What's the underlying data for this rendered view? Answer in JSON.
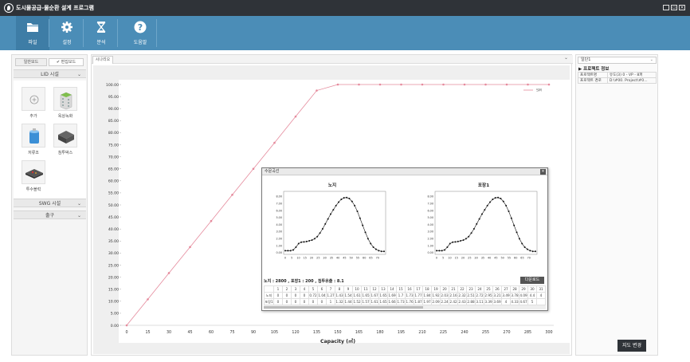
{
  "window": {
    "title": "도시물공급-물순환 설계 프로그램",
    "controls": [
      "_",
      "▭",
      "×"
    ]
  },
  "toolbar": {
    "buttons": [
      {
        "label": "파일",
        "icon": "folder-icon"
      },
      {
        "label": "설정",
        "icon": "gear-icon"
      },
      {
        "label": "분석",
        "icon": "hourglass-icon"
      },
      {
        "label": "도움말",
        "icon": "question-icon"
      }
    ]
  },
  "left": {
    "mode_general": "일반모드",
    "mode_edit": "✔ 편집모드",
    "lid_section": "LID 시설",
    "lid_items": [
      {
        "label": "추가",
        "icon": "add-icon"
      },
      {
        "label": "옥상녹화",
        "icon": "green-roof-icon"
      },
      {
        "label": "저류조",
        "icon": "storage-tank-icon"
      },
      {
        "label": "침투박스",
        "icon": "infiltration-box-icon"
      },
      {
        "label": "투수블럭",
        "icon": "permeable-block-icon"
      }
    ],
    "swg_section": "SWG 시설",
    "outlet_section": "출구"
  },
  "main": {
    "tab_label": "시나리오",
    "dropdown": "⌄"
  },
  "chart_data": {
    "type": "line",
    "series": [
      {
        "name": "SM",
        "x": [
          0,
          15,
          30,
          45,
          60,
          75,
          90,
          105,
          120,
          135,
          150,
          165,
          180,
          195,
          210,
          225,
          240,
          255,
          270,
          285,
          300
        ],
        "y": [
          0,
          10.8,
          21.7,
          32.5,
          43.3,
          54.2,
          65,
          75.8,
          86.7,
          97.5,
          100,
          100,
          100,
          100,
          100,
          100,
          100,
          100,
          100,
          100,
          100
        ],
        "color": "#e58a9c"
      }
    ],
    "xlabel": "Capacity (㎥)",
    "ylabel": "",
    "xticks": [
      0,
      15,
      30,
      45,
      60,
      75,
      90,
      105,
      120,
      135,
      150,
      165,
      180,
      195,
      210,
      225,
      240,
      255,
      270,
      285,
      300
    ],
    "yticks": [
      "0.00",
      "5.00",
      "10.00",
      "15.00",
      "20.00",
      "25.00",
      "30.00",
      "35.00",
      "40.00",
      "45.00",
      "50.00",
      "55.00",
      "60.00",
      "65.00",
      "70.00",
      "75.00",
      "80.00",
      "85.00",
      "90.00",
      "95.00",
      "100.00"
    ],
    "xlim": [
      0,
      300
    ],
    "ylim": [
      0,
      100
    ],
    "legend": "top-right",
    "grid": false
  },
  "popup": {
    "title": "수문곡선",
    "close": "×",
    "charts": [
      {
        "title": "노지"
      },
      {
        "title": "포장1"
      }
    ],
    "mini_xticks": [
      0,
      5,
      10,
      15,
      20,
      25,
      30,
      35,
      40,
      45,
      50,
      55,
      60,
      65,
      70
    ],
    "mini_yticks": [
      "0.00",
      "1.00",
      "2.00",
      "3.00",
      "4.00",
      "5.00",
      "6.00",
      "7.00",
      "8.00"
    ],
    "mini_profile": [
      0.3,
      0.3,
      0.3,
      0.4,
      0.8,
      1.3,
      1.5,
      1.55,
      1.6,
      1.7,
      1.8,
      2.0,
      2.3,
      2.8,
      3.4,
      4.1,
      4.8,
      5.5,
      6.1,
      6.7,
      7.2,
      7.6,
      7.8,
      7.85,
      7.7,
      7.3,
      6.7,
      5.9,
      4.9,
      3.9,
      2.9,
      2.0,
      1.3,
      0.8,
      0.5,
      0.3,
      0.2,
      0.2
    ],
    "info": "노지 : 2800 , 포장1 : 200 , 침투유출 : 8.1",
    "download": "다운로드",
    "table": {
      "header": [
        "",
        "1",
        "2",
        "3",
        "4",
        "5",
        "6",
        "7",
        "8",
        "9",
        "10",
        "11",
        "12",
        "13",
        "14",
        "15",
        "16",
        "17",
        "18",
        "19",
        "20",
        "21",
        "22",
        "23",
        "24",
        "25",
        "26",
        "27",
        "28",
        "29",
        "30",
        "31"
      ],
      "rows": [
        [
          "노지",
          "0",
          "0",
          "0",
          "0",
          "0.72",
          "1.04",
          "1.27",
          "1.43",
          "1.54",
          "1.61",
          "1.65",
          "1.67",
          "1.65",
          "1.69",
          "1.7",
          "1.73",
          "1.77",
          "1.84",
          "1.92",
          "2.03",
          "2.16",
          "2.32",
          "2.51",
          "2.72",
          "2.95",
          "3.21",
          "3.49",
          "3.78",
          "4.09",
          "4.4",
          "4"
        ],
        [
          "포장1",
          "0",
          "0",
          "0",
          "0",
          "0",
          "0",
          "1",
          "1.32",
          "1.44",
          "1.52",
          "1.57",
          "1.61",
          "1.65",
          "1.66",
          "1.73",
          "1.76",
          "1.87",
          "1.97",
          "2.09",
          "2.24",
          "2.42",
          "2.43",
          "2.88",
          "3.11",
          "3.39",
          "3.69",
          "4",
          "4.33",
          "4.67",
          "5",
          ""
        ]
      ]
    }
  },
  "right": {
    "select_value": "일단1",
    "section_title": "▶ 프로젝트 정보",
    "rows": [
      {
        "key": "프로젝트명",
        "value": "유도(3) 0 - VP - 8퍼"
      },
      {
        "key": "프로젝트 경로",
        "value": "D:\\#00. Project\\#0..."
      }
    ],
    "map_button": "지도 변경"
  }
}
